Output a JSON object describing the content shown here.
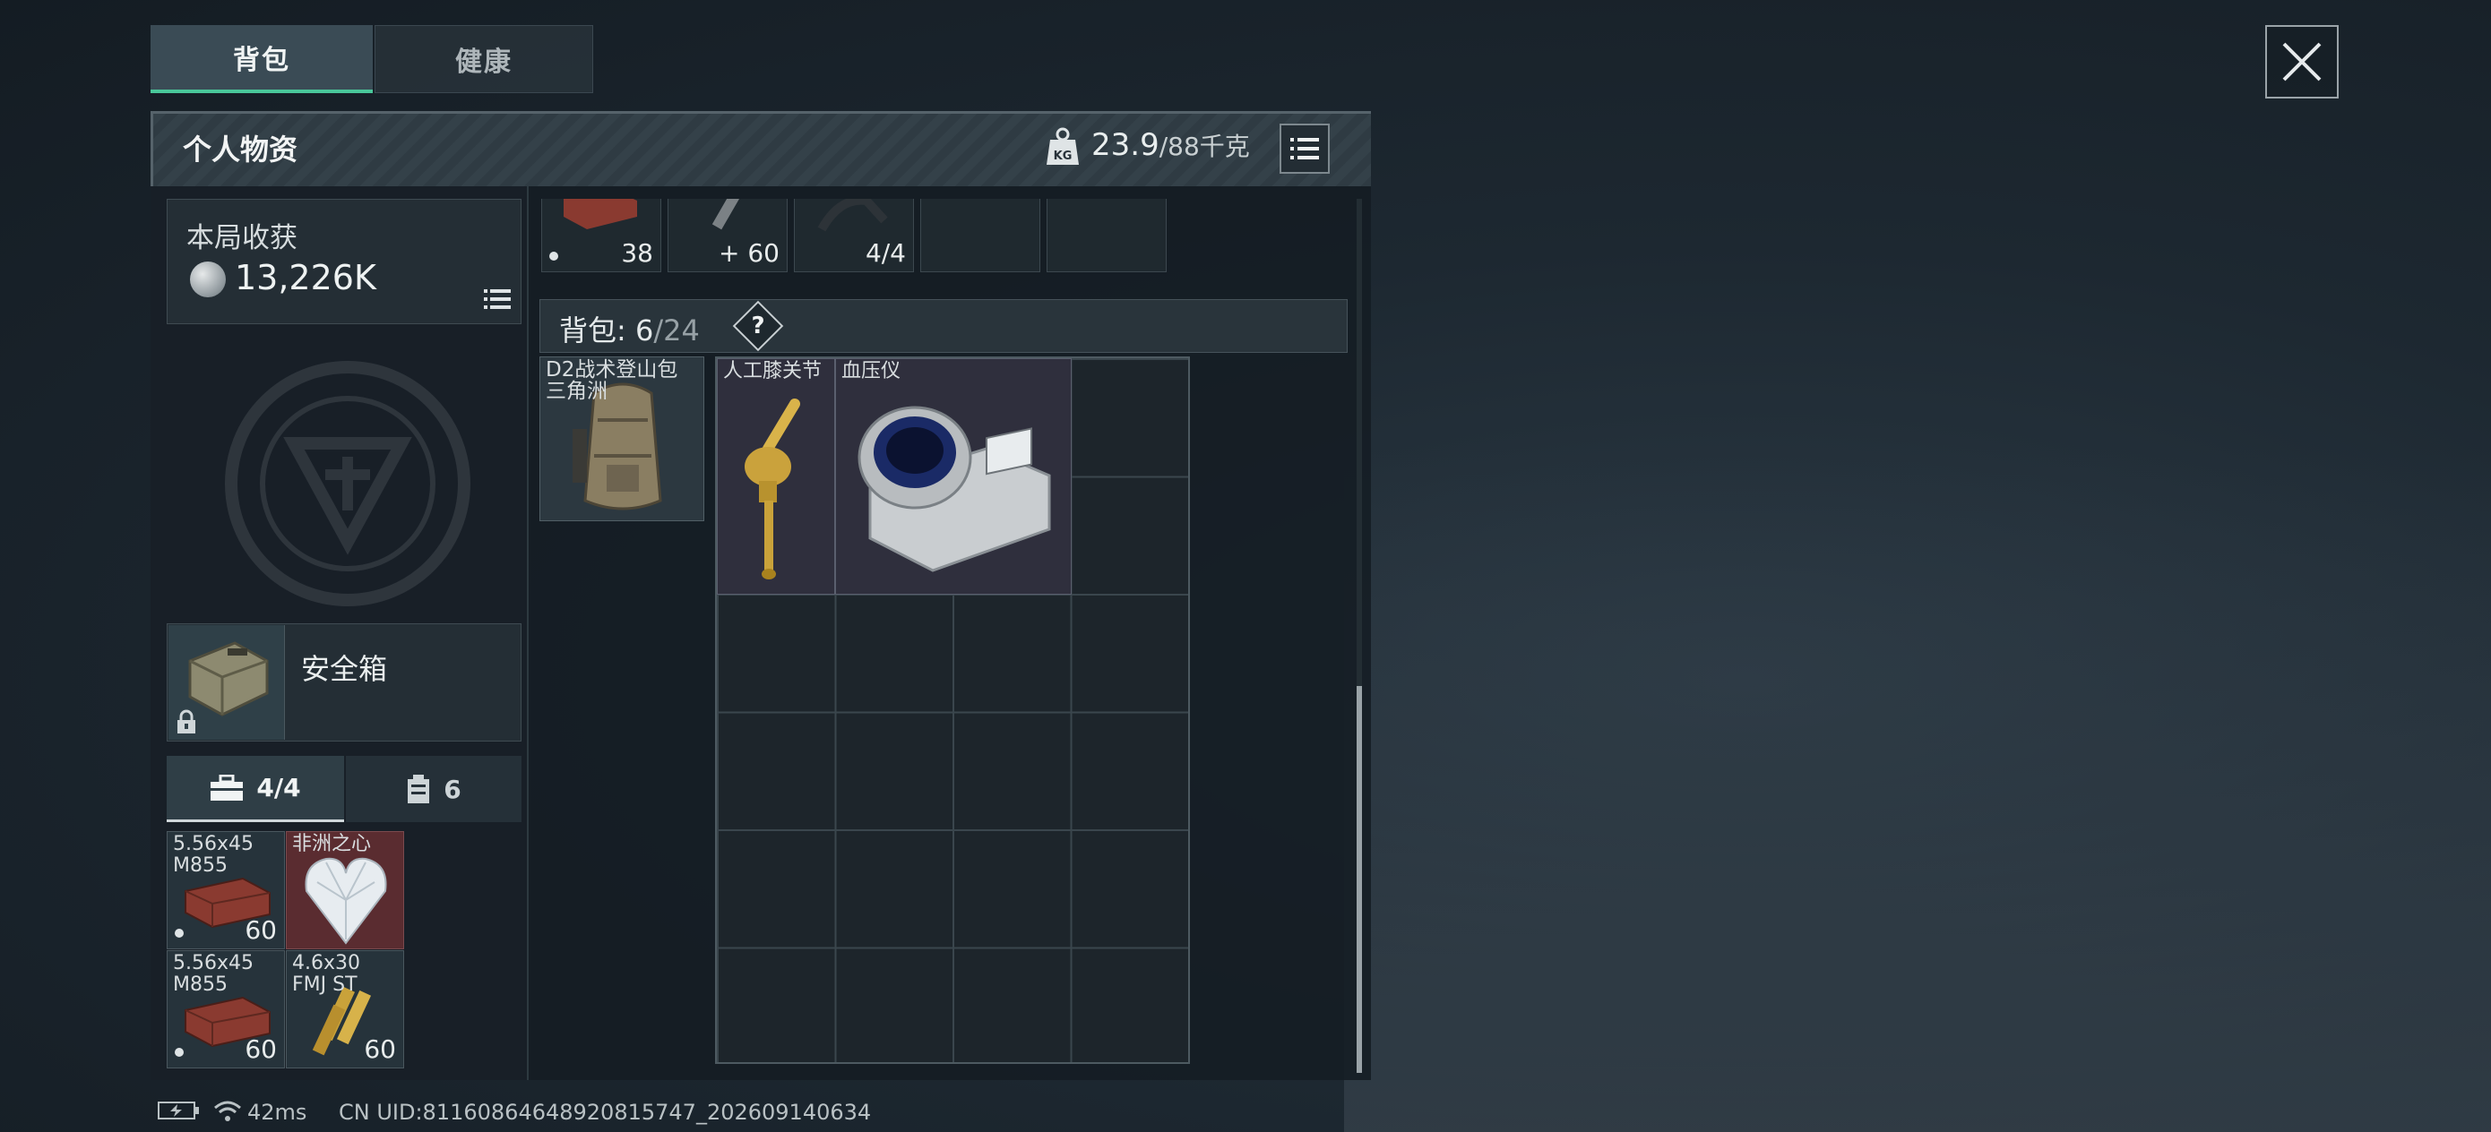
{
  "tabs": [
    {
      "label": "背包",
      "active": true
    },
    {
      "label": "健康",
      "active": false
    }
  ],
  "close_icon": "close-x-icon",
  "panel": {
    "title": "个人物资",
    "weight_current": "23.9",
    "weight_max": "/88千克",
    "weight_icon": "kg-weight-icon"
  },
  "income": {
    "label": "本局收获",
    "value": "13,226K"
  },
  "top_slots": [
    {
      "count": "38",
      "has_dot": true
    },
    {
      "count": "60",
      "prefix": "+"
    },
    {
      "count": "4/4"
    },
    {
      "count": ""
    },
    {
      "count": ""
    }
  ],
  "backpack": {
    "label": "背包:",
    "used": "6",
    "capacity": "/24",
    "help": "?",
    "bag_item": {
      "name": "D2战术登山包",
      "name2": "三角洲"
    },
    "items": [
      {
        "name": "人工膝关节"
      },
      {
        "name": "血压仪"
      }
    ]
  },
  "safebox": {
    "label": "安全箱"
  },
  "subtabs": [
    {
      "label": "4/4",
      "icon": "toolbox-icon"
    },
    {
      "label": "6",
      "icon": "canister-icon"
    }
  ],
  "secure_items": [
    {
      "line1": "5.56x45",
      "line2": "M855",
      "count": "60",
      "has_dot": true
    },
    {
      "line1": "非洲之心",
      "line2": "",
      "count": ""
    },
    {
      "line1": "5.56x45",
      "line2": "M855",
      "count": "60",
      "has_dot": true
    },
    {
      "line1": "4.6x30",
      "line2": "FMJ ST",
      "count": "60"
    }
  ],
  "status_bar": {
    "ping": "42ms",
    "uid": "CN UID:81160864648920815747_202609140634"
  },
  "colors": {
    "accent_green": "#49c79a",
    "rare_red": "#5a2c30",
    "panel_bg": "#141c23"
  }
}
